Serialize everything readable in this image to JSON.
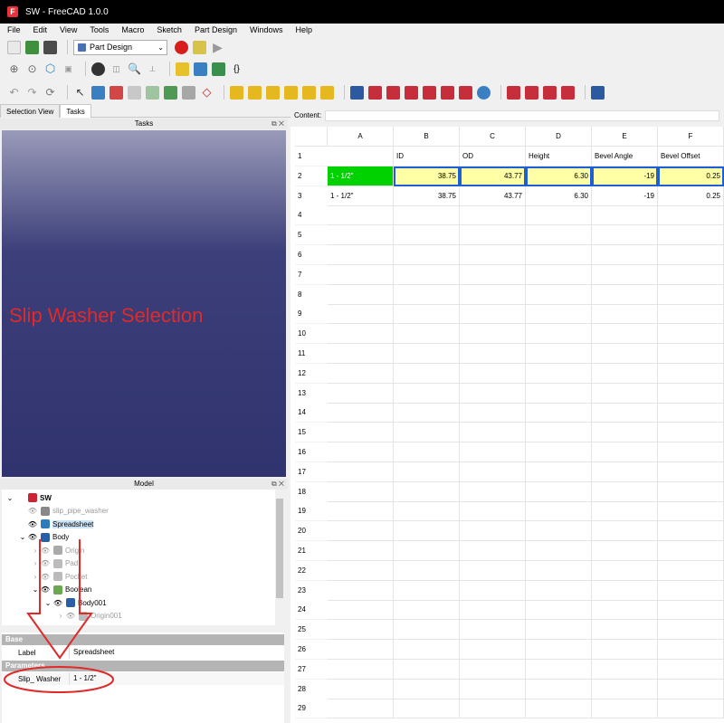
{
  "window": {
    "title": "SW - FreeCAD 1.0.0"
  },
  "menubar": [
    "File",
    "Edit",
    "View",
    "Tools",
    "Macro",
    "Sketch",
    "Part Design",
    "Windows",
    "Help"
  ],
  "toolbar": {
    "workbench": "Part Design"
  },
  "left_panel": {
    "tabs": [
      "Selection View",
      "Tasks"
    ],
    "tasks_title": "Tasks",
    "overlay_text": "Slip Washer Selection",
    "model_title": "Model",
    "tree": [
      {
        "label": "SW",
        "level": 0,
        "expanded": true
      },
      {
        "label": "slip_pipe_washer",
        "level": 1,
        "dim": true
      },
      {
        "label": "Spreadsheet",
        "level": 1,
        "selected": true
      },
      {
        "label": "Body",
        "level": 1,
        "expanded": true
      },
      {
        "label": "Origin",
        "level": 2,
        "dim": true
      },
      {
        "label": "Pad",
        "level": 2,
        "dim": true
      },
      {
        "label": "Pocket",
        "level": 2,
        "dim": true
      },
      {
        "label": "Boolean",
        "level": 2,
        "expanded": true
      },
      {
        "label": "Body001",
        "level": 3,
        "expanded": true
      },
      {
        "label": "Origin001",
        "level": 4,
        "dim": true
      }
    ],
    "properties": {
      "group_base": "Base",
      "label_key": "Label",
      "label_value": "Spreadsheet",
      "group_params": "Parameters",
      "param_key": "Slip_ Washer",
      "param_value": "1 - 1/2\""
    }
  },
  "content_label": "Content:",
  "sheet": {
    "columns": [
      "A",
      "B",
      "C",
      "D",
      "E",
      "F"
    ],
    "rows": [
      [
        "",
        "ID",
        "OD",
        "Height",
        "Bevel Angle",
        "Bevel Offset"
      ],
      [
        "1 - 1/2\"",
        "38.75",
        "43.77",
        "6.30",
        "-19",
        "0.25"
      ],
      [
        "1 - 1/2\"",
        "38.75",
        "43.77",
        "6.30",
        "-19",
        "0.25"
      ]
    ],
    "row_numbers": [
      "1",
      "2",
      "3",
      "4",
      "5",
      "6",
      "7",
      "8",
      "9",
      "10",
      "11",
      "12",
      "13",
      "14",
      "15",
      "16",
      "17",
      "18",
      "19",
      "20",
      "21",
      "22",
      "23",
      "24",
      "25",
      "26",
      "27",
      "28",
      "29"
    ]
  },
  "colors": {
    "annotation": "#e02a2a",
    "selection_green": "#00d200",
    "highlight": "#ffffa5"
  }
}
